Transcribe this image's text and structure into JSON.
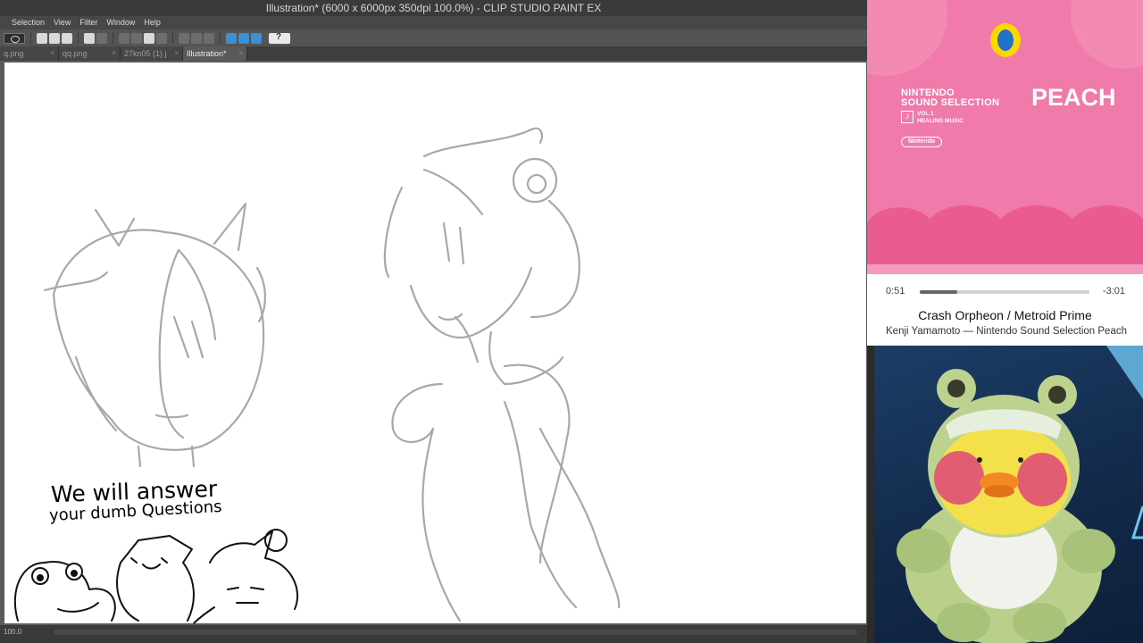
{
  "window": {
    "title": "Illustration* (6000 x 6000px 350dpi 100.0%)  - CLIP STUDIO PAINT EX"
  },
  "menu": [
    "Selection",
    "View",
    "Filter",
    "Window",
    "Help"
  ],
  "tabs": [
    {
      "label": "q.png",
      "active": false
    },
    {
      "label": "qq.png",
      "active": false
    },
    {
      "label": "27kn05 (1) j",
      "active": false
    },
    {
      "label": "Illustration*",
      "active": true
    }
  ],
  "canvas": {
    "caption_line1": "We will answer",
    "caption_line2": "your dumb Questions"
  },
  "status": {
    "zoom": "100.0"
  },
  "music": {
    "album_title_line1": "NINTENDO",
    "album_title_line2": "SOUND SELECTION",
    "album_sub_line1": "VOL.1",
    "album_sub_line2": "HEALING MUSIC",
    "album_name": "PEACH",
    "label": "Nintendo",
    "time_elapsed": "0:51",
    "time_remaining": "-3:01",
    "progress": 0.22,
    "track_title": "Crash Orpheon / Metroid Prime",
    "track_artist": "Kenji Yamamoto — Nintendo Sound Selection Peach"
  },
  "colors": {
    "album_pink": "#f07aa9",
    "album_dark_pink": "#ea5b92",
    "cam_blue": "#1d3d66"
  }
}
